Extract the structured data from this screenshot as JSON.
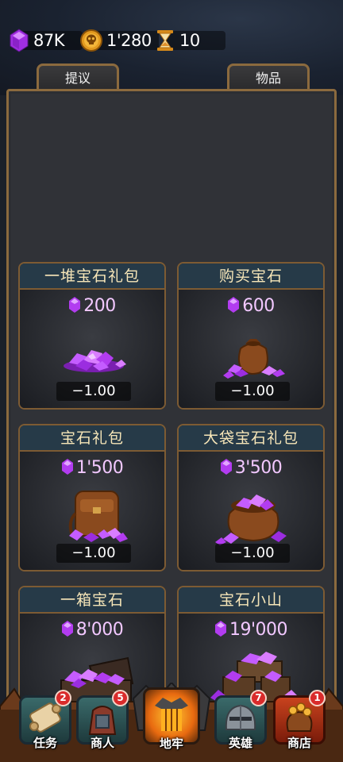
{
  "currency": {
    "gems": "87K",
    "coins": "1'280",
    "hourglass": "10"
  },
  "tabs": {
    "left": "提议",
    "right": "物品"
  },
  "offers": [
    {
      "title": "一堆宝石礼包",
      "price": "200",
      "cost": "−1.00",
      "icon": "gem-pile-icon"
    },
    {
      "title": "购买宝石",
      "price": "600",
      "cost": "−1.00",
      "icon": "gem-sack-icon"
    },
    {
      "title": "宝石礼包",
      "price": "1'500",
      "cost": "−1.00",
      "icon": "gem-backpack-icon"
    },
    {
      "title": "大袋宝石礼包",
      "price": "3'500",
      "cost": "−1.00",
      "icon": "gem-big-sack-icon"
    },
    {
      "title": "一箱宝石",
      "price": "8'000",
      "cost": "",
      "icon": "gem-chest-icon"
    },
    {
      "title": "宝石小山",
      "price": "19'000",
      "cost": "",
      "icon": "gem-mountain-icon"
    }
  ],
  "nav": [
    {
      "label": "任务",
      "badge": "2",
      "icon": "scroll-icon"
    },
    {
      "label": "商人",
      "badge": "5",
      "icon": "merchant-icon"
    },
    {
      "label": "地牢",
      "badge": "",
      "icon": "dungeon-gate-icon"
    },
    {
      "label": "英雄",
      "badge": "7",
      "icon": "helmet-icon"
    },
    {
      "label": "商店",
      "badge": "1",
      "icon": "gold-bag-icon"
    }
  ],
  "colors": {
    "gem": "#b23cf0",
    "card_border": "#7d5b33",
    "card_title_bg": "#263a48",
    "badge": "#d92b2b"
  }
}
